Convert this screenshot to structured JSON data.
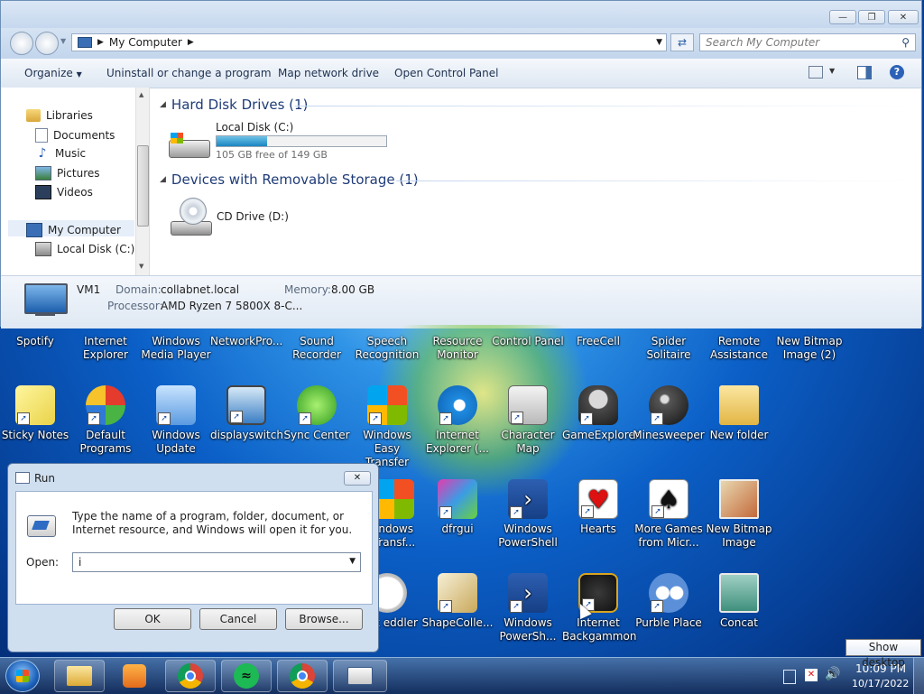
{
  "explorer": {
    "address": {
      "path": "My Computer"
    },
    "search": {
      "placeholder": "Search My Computer"
    },
    "toolbar": {
      "organize": "Organize",
      "uninstall": "Uninstall or change a program",
      "map_drive": "Map network drive",
      "control_panel": "Open Control Panel"
    },
    "nav": {
      "libraries": "Libraries",
      "documents": "Documents",
      "music": "Music",
      "pictures": "Pictures",
      "videos": "Videos",
      "my_computer": "My Computer",
      "local_disk": "Local Disk (C:)"
    },
    "groups": {
      "hdd_header": "Hard Disk Drives (1)",
      "removable_header": "Devices with Removable Storage (1)"
    },
    "drives": {
      "c_name": "Local Disk (C:)",
      "c_free": "105 GB free of 149 GB",
      "c_used_fraction": 0.3,
      "d_name": "CD Drive (D:)"
    },
    "details": {
      "computer_name": "VM1",
      "domain_label": "Domain:",
      "domain_value": "collabnet.local",
      "memory_label": "Memory:",
      "memory_value": "8.00 GB",
      "processor_label": "Processor:",
      "processor_value": "AMD Ryzen 7 5800X 8-C..."
    }
  },
  "desktop_icons": {
    "row1": [
      "Spotify",
      "Internet Explorer",
      "Windows Media Player",
      "NetworkPro...",
      "Sound Recorder",
      "Speech Recognition",
      "Resource Monitor",
      "Control Panel",
      "FreeCell",
      "Spider Solitaire",
      "Remote Assistance",
      "New Bitmap Image (2)"
    ],
    "row2": [
      "Sticky Notes",
      "Default Programs",
      "Windows Update",
      "displayswitch",
      "Sync Center",
      "Windows Easy Transfer",
      "Internet Explorer (...",
      "Character Map",
      "GameExplorer",
      "Minesweeper",
      "New folder"
    ],
    "row3": [
      "indows Transf...",
      "dfrgui",
      "Windows PowerShell",
      "Hearts",
      "More Games from Micr...",
      "New Bitmap Image"
    ],
    "row4": [
      "Task eddler",
      "ShapeColle...",
      "Windows PowerSh...",
      "Internet Backgammon",
      "Purble Place",
      "Concat"
    ]
  },
  "run": {
    "title": "Run",
    "description": "Type the name of a program, folder, document, or Internet resource, and Windows will open it for you.",
    "open_label": "Open:",
    "open_value": "i",
    "ok": "OK",
    "cancel": "Cancel",
    "browse": "Browse..."
  },
  "taskbar": {
    "time": "10:09 PM",
    "date": "10/17/2022",
    "show_desktop_tooltip": "Show desktop"
  }
}
